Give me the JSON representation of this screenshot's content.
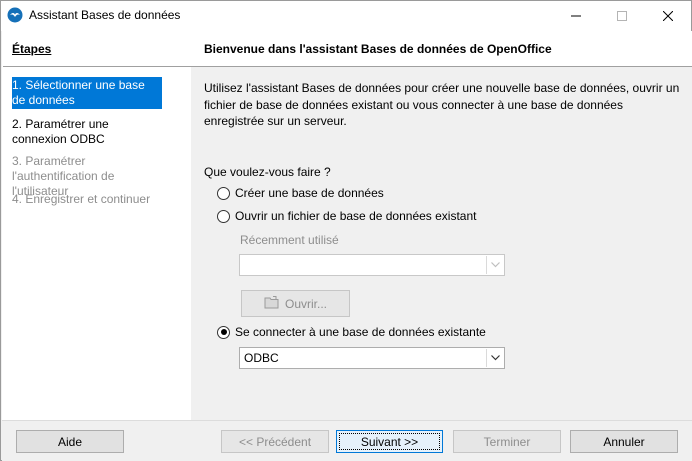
{
  "window": {
    "title": "Assistant Bases de données"
  },
  "steps": {
    "title": "Étapes",
    "items": [
      {
        "label": "1. Sélectionner une base de données",
        "state": "selected"
      },
      {
        "label": "2. Paramétrer une connexion ODBC",
        "state": "enabled"
      },
      {
        "label": "3. Paramétrer l'authentification de l'utilisateur",
        "state": "disabled"
      },
      {
        "label": "4. Enregistrer et continuer",
        "state": "disabled"
      }
    ]
  },
  "content": {
    "header_title": "Bienvenue dans l'assistant Bases de données de OpenOffice",
    "description": "Utilisez l'assistant Bases de données pour créer une nouvelle base de données, ouvrir un fichier de base de données existant ou vous connecter à une base de données enregistrée sur un serveur.",
    "question": "Que voulez-vous faire ?",
    "options": {
      "create_label": "Créer une base de données",
      "open_label": "Ouvrir un fichier de base de données existant",
      "connect_label": "Se connecter à une base de données existante",
      "selected": "connect"
    },
    "recent_label": "Récemment utilisé",
    "recent_value": "",
    "open_button_label": "Ouvrir...",
    "connection_type_value": "ODBC"
  },
  "buttons": {
    "help": "Aide",
    "back": "<< Précédent",
    "next": "Suivant >>",
    "finish": "Terminer",
    "cancel": "Annuler"
  },
  "colors": {
    "accent": "#0078d7",
    "disabled_text": "#8d8d8d",
    "panel_bg": "#f0f0f0"
  }
}
